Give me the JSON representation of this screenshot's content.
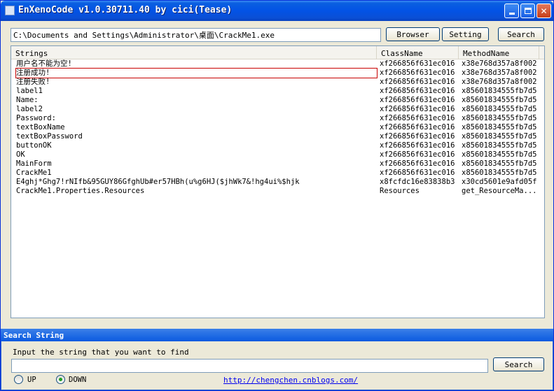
{
  "window": {
    "title": "EnXenoCode v1.0.30711.40 by cici(Tease)"
  },
  "toolbar": {
    "path_value": "C:\\Documents and Settings\\Administrator\\桌面\\CrackMe1.exe",
    "browser_label": "Browser",
    "setting_label": "Setting",
    "search_label": "Search"
  },
  "list": {
    "columns": [
      "Strings",
      "ClassName",
      "MethodName"
    ],
    "rows": [
      [
        "用户名不能为空!",
        "xf266856f631ec016",
        "x38e768d357a8f002"
      ],
      [
        "注册成功!",
        "xf266856f631ec016",
        "x38e768d357a8f002"
      ],
      [
        "注册失败!",
        "xf266856f631ec016",
        "x38e768d357a8f002"
      ],
      [
        "label1",
        "xf266856f631ec016",
        "x85601834555fb7d5"
      ],
      [
        "Name:",
        "xf266856f631ec016",
        "x85601834555fb7d5"
      ],
      [
        "label2",
        "xf266856f631ec016",
        "x85601834555fb7d5"
      ],
      [
        "Password:",
        "xf266856f631ec016",
        "x85601834555fb7d5"
      ],
      [
        "textBoxName",
        "xf266856f631ec016",
        "x85601834555fb7d5"
      ],
      [
        "textBoxPassword",
        "xf266856f631ec016",
        "x85601834555fb7d5"
      ],
      [
        "buttonOK",
        "xf266856f631ec016",
        "x85601834555fb7d5"
      ],
      [
        "OK",
        "xf266856f631ec016",
        "x85601834555fb7d5"
      ],
      [
        "MainForm",
        "xf266856f631ec016",
        "x85601834555fb7d5"
      ],
      [
        "CrackMe1",
        "xf266856f631ec016",
        "x85601834555fb7d5"
      ],
      [
        "E4ghj*Ghg7!rNIfb&95GUY86GfghUb#er57HBh(u%g6HJ($jhWk7&!hg4ui%$hjk",
        "x8fcfdc16e83838b3",
        "x30cd5601e9afd05f"
      ],
      [
        "CrackMe1.Properties.Resources",
        "Resources",
        "get_ResourceMa..."
      ]
    ],
    "selected_index": 1
  },
  "search_panel": {
    "title": "Search String",
    "prompt": "Input the string that you want to find",
    "input_value": "",
    "search_label": "Search",
    "radio_up": "UP",
    "radio_down": "DOWN",
    "selected_direction": "DOWN",
    "link": "http://chengchen.cnblogs.com/"
  }
}
